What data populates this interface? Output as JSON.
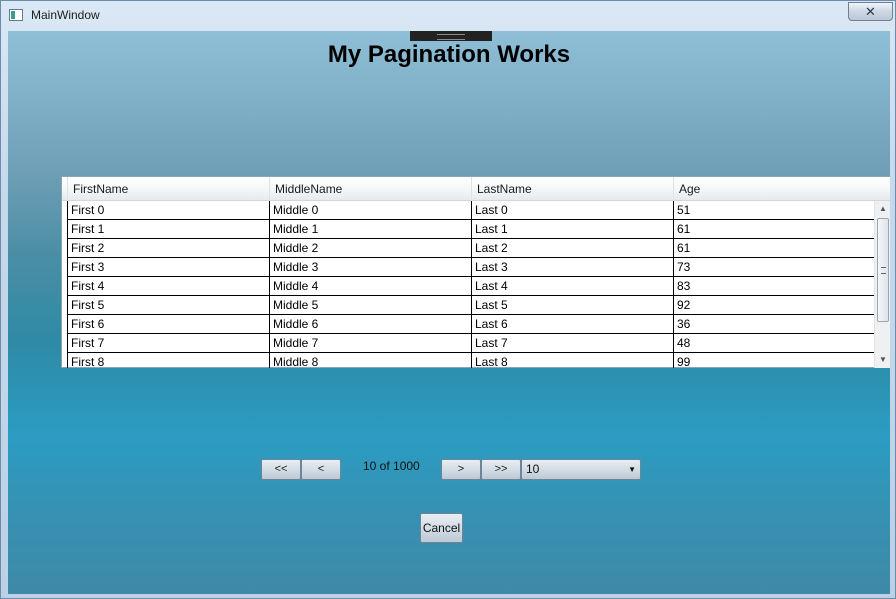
{
  "window": {
    "title": "MainWindow",
    "close_glyph": "✕"
  },
  "page": {
    "title": "My Pagination Works"
  },
  "grid": {
    "columns": [
      "FirstName",
      "MiddleName",
      "LastName",
      "Age"
    ],
    "rows": [
      [
        "First 0",
        "Middle 0",
        "Last 0",
        "51"
      ],
      [
        "First 1",
        "Middle 1",
        "Last 1",
        "61"
      ],
      [
        "First 2",
        "Middle 2",
        "Last 2",
        "61"
      ],
      [
        "First 3",
        "Middle 3",
        "Last 3",
        "73"
      ],
      [
        "First 4",
        "Middle 4",
        "Last 4",
        "83"
      ],
      [
        "First 5",
        "Middle 5",
        "Last 5",
        "92"
      ],
      [
        "First 6",
        "Middle 6",
        "Last 6",
        "36"
      ],
      [
        "First 7",
        "Middle 7",
        "Last 7",
        "48"
      ],
      [
        "First 8",
        "Middle 8",
        "Last 8",
        "99"
      ]
    ],
    "scroll_up_glyph": "▲",
    "scroll_down_glyph": "▼"
  },
  "pagination": {
    "first_label": "<<",
    "prev_label": "<",
    "status": "10 of 1000",
    "next_label": ">",
    "last_label": ">>",
    "page_size": "10",
    "dropdown_glyph": "▼"
  },
  "actions": {
    "cancel_label": "Cancel"
  }
}
